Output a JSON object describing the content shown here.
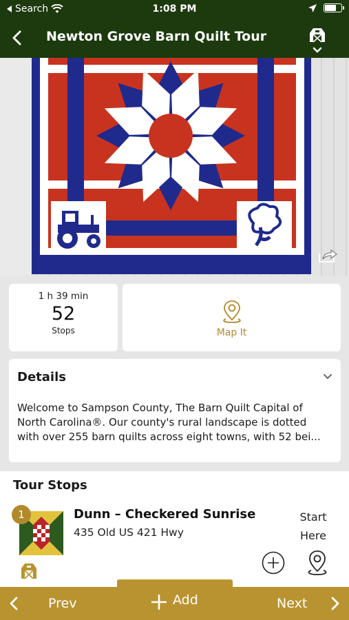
{
  "status_bar": {
    "back_app_label": "Search",
    "time": "1:08 PM"
  },
  "nav": {
    "title": "Newton Grove Barn Quilt Tour"
  },
  "tour_stats": {
    "duration": "1 h 39 min",
    "stop_count": "52",
    "stop_label": "Stops"
  },
  "map_button": {
    "label": "Map It"
  },
  "details": {
    "title": "Details",
    "lines": [
      "Welcome to Sampson County, The Barn Quilt Capital of",
      "North Carolina®. Our county's rural landscape is dotted",
      "with over 255 barn quilts across eight towns, with 52 bei..."
    ]
  },
  "tour_stops": {
    "title": "Tour Stops",
    "items": [
      {
        "number": "1",
        "name": "Dunn – Checkered Sunrise",
        "address": "435 Old US 421 Hwy",
        "start_label_1": "Start",
        "start_label_2": "Here"
      }
    ]
  },
  "bottom_bar": {
    "prev_label": "Prev",
    "add_label": "Add",
    "next_label": "Next"
  },
  "colors": {
    "header_green": "#1d3a0f",
    "accent_gold": "#b99330",
    "quilt_red": "#c8331f",
    "quilt_blue": "#1f2a8c"
  }
}
